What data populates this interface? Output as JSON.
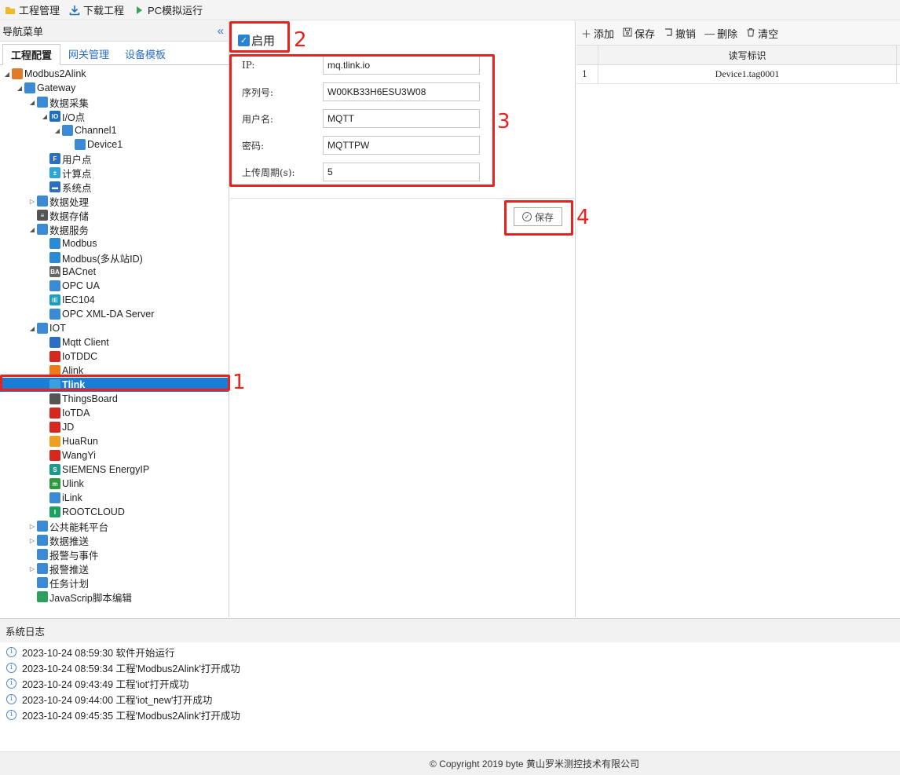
{
  "toolbar": {
    "project_manage": "工程管理",
    "download_project": "下载工程",
    "pc_simulate": "PC模拟运行"
  },
  "nav": {
    "title": "导航菜单",
    "collapse_glyph": "«",
    "tabs": [
      "工程配置",
      "网关管理",
      "设备模板"
    ]
  },
  "tree": [
    {
      "label": "Modbus2Alink",
      "icon": "stack-icon",
      "color": "#e07b2a"
    },
    {
      "label": "Gateway",
      "icon": "gateway-icon",
      "color": "#3a8ad6"
    },
    {
      "label": "数据采集",
      "icon": "data-collect-icon",
      "color": "#3a8ad6"
    },
    {
      "label": "I/O点",
      "icon": "io-icon",
      "color": "#1a6fc4"
    },
    {
      "label": "Channel1",
      "icon": "channel-icon",
      "color": "#3a8ad6"
    },
    {
      "label": "Device1",
      "icon": "device-icon",
      "color": "#3a8ad6"
    },
    {
      "label": "用户点",
      "icon": "user-point-icon",
      "color": "#2a6fc4"
    },
    {
      "label": "计算点",
      "icon": "calc-point-icon",
      "color": "#2ba5d8"
    },
    {
      "label": "系统点",
      "icon": "system-point-icon",
      "color": "#2a6fc4"
    },
    {
      "label": "数据处理",
      "icon": "data-process-icon",
      "color": "#3a8ad6"
    },
    {
      "label": "数据存储",
      "icon": "database-icon",
      "color": "#555555"
    },
    {
      "label": "数据服务",
      "icon": "data-service-icon",
      "color": "#3a8ad6"
    },
    {
      "label": "Modbus",
      "icon": "modbus-icon",
      "color": "#2a8ad6"
    },
    {
      "label": "Modbus(多从站ID)",
      "icon": "modbus-multi-icon",
      "color": "#2a8ad6"
    },
    {
      "label": "BACnet",
      "icon": "bacnet-icon",
      "color": "#666666"
    },
    {
      "label": "OPC UA",
      "icon": "opcua-icon",
      "color": "#3a8ad6"
    },
    {
      "label": "IEC104",
      "icon": "iec104-icon",
      "color": "#1aa0c8"
    },
    {
      "label": "OPC XML-DA Server",
      "icon": "opc-xml-icon",
      "color": "#3a8ad6"
    },
    {
      "label": "IOT",
      "icon": "iot-icon",
      "color": "#3a8ad6"
    },
    {
      "label": "Mqtt Client",
      "icon": "mqtt-icon",
      "color": "#2a6fc4"
    },
    {
      "label": "IoTDDC",
      "icon": "iotddc-icon",
      "color": "#d6281f"
    },
    {
      "label": "Alink",
      "icon": "alink-icon",
      "color": "#f07a1a"
    },
    {
      "label": "Tlink",
      "icon": "tlink-icon",
      "color": "#3aa0e0"
    },
    {
      "label": "ThingsBoard",
      "icon": "thingsboard-icon",
      "color": "#555555"
    },
    {
      "label": "IoTDA",
      "icon": "huawei-icon",
      "color": "#d6281f"
    },
    {
      "label": "JD",
      "icon": "jd-icon",
      "color": "#d6281f"
    },
    {
      "label": "HuaRun",
      "icon": "huarun-icon",
      "color": "#f0a020"
    },
    {
      "label": "WangYi",
      "icon": "wangyi-icon",
      "color": "#d6281f"
    },
    {
      "label": "SIEMENS EnergyIP",
      "icon": "siemens-icon",
      "color": "#1a9a8a"
    },
    {
      "label": "Ulink",
      "icon": "ulink-icon",
      "color": "#2a9a3a"
    },
    {
      "label": "iLink",
      "icon": "ilink-icon",
      "color": "#3a8ad6"
    },
    {
      "label": "ROOTCLOUD",
      "icon": "rootcloud-icon",
      "color": "#1aa060"
    },
    {
      "label": "公共能耗平台",
      "icon": "energy-platform-icon",
      "color": "#3a8ad6"
    },
    {
      "label": "数据推送",
      "icon": "data-push-icon",
      "color": "#3a8ad6"
    },
    {
      "label": "报警与事件",
      "icon": "alarm-bell-icon",
      "color": "#3a8ad6"
    },
    {
      "label": "报警推送",
      "icon": "alarm-push-icon",
      "color": "#3a8ad6"
    },
    {
      "label": "任务计划",
      "icon": "calendar-icon",
      "color": "#3a8ad6"
    },
    {
      "label": "JavaScrip脚本编辑",
      "icon": "script-icon",
      "color": "#2aa05a"
    }
  ],
  "form": {
    "enable_label": "启用",
    "fields": [
      {
        "label": "IP:",
        "value": "mq.tlink.io"
      },
      {
        "label": "序列号:",
        "value": "W00KB33H6ESU3W08"
      },
      {
        "label": "用户名:",
        "value": "MQTT"
      },
      {
        "label": "密码:",
        "value": "MQTTPW"
      },
      {
        "label": "上传周期(s):",
        "value": "5"
      }
    ],
    "save_label": "保存"
  },
  "right_toolbar": {
    "add": "添加",
    "save": "保存",
    "undo": "撤销",
    "delete": "删除",
    "clear": "清空"
  },
  "grid": {
    "header": "读写标识",
    "rows": [
      {
        "num": "1",
        "tag": "Device1.tag0001"
      }
    ]
  },
  "log": {
    "title": "系统日志",
    "lines": [
      "2023-10-24 08:59:30 软件开始运行",
      "2023-10-24 08:59:34 工程'Modbus2Alink'打开成功",
      "2023-10-24 09:43:49 工程'iot'打开成功",
      "2023-10-24 09:44:00 工程'iot_new'打开成功",
      "2023-10-24 09:45:35 工程'Modbus2Alink'打开成功"
    ]
  },
  "footer": "© Copyright 2019 byte 黄山罗米测控技术有限公司",
  "annotations": [
    "1",
    "2",
    "3",
    "4"
  ],
  "colors": {
    "annotation": "#e8231f",
    "selection": "#1a7fd4",
    "accent": "#2a82d4"
  }
}
